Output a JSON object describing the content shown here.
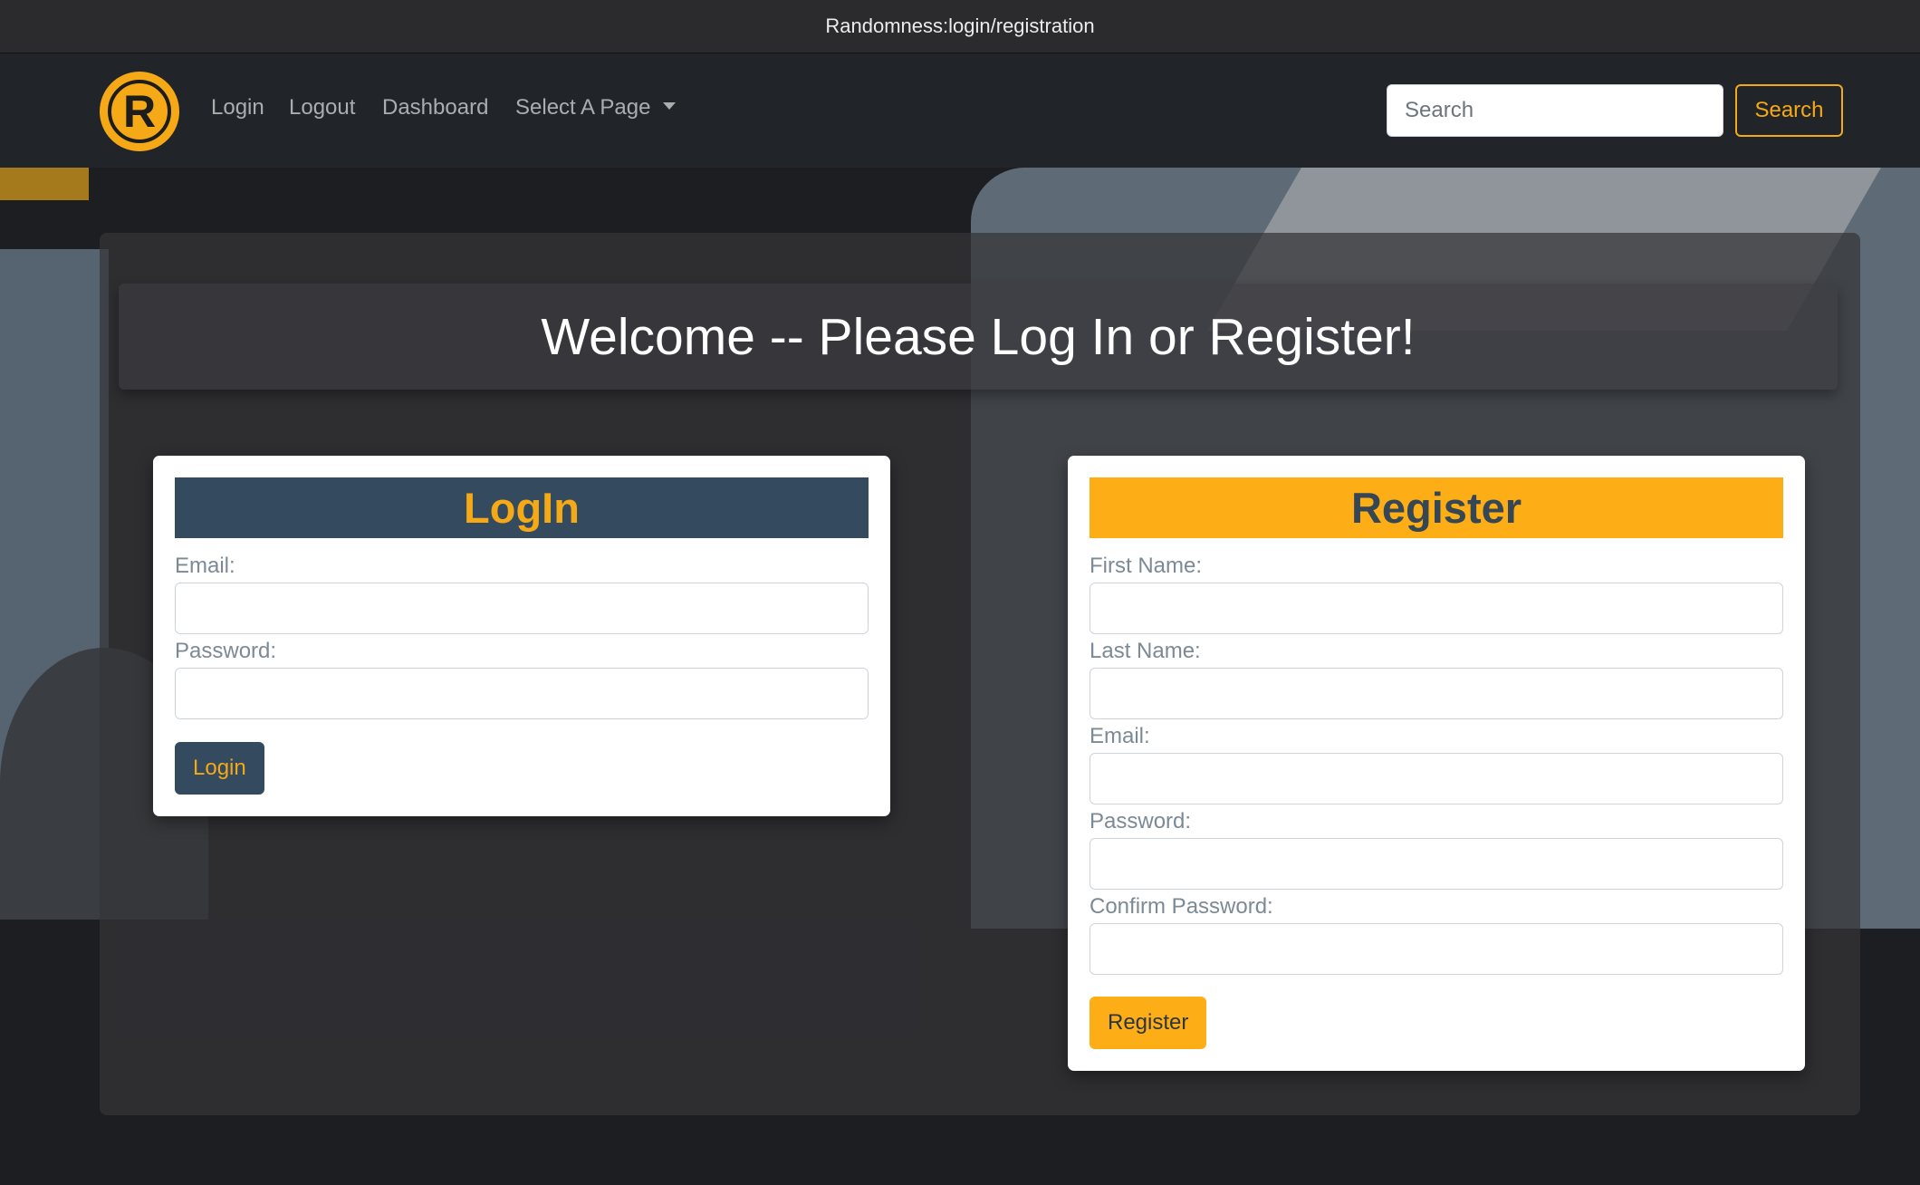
{
  "window": {
    "title": "Randomness:login/registration"
  },
  "navbar": {
    "logo_letter": "R",
    "links": [
      "Login",
      "Logout",
      "Dashboard"
    ],
    "dropdown_label": "Select A Page",
    "search_placeholder": "Search",
    "search_button": "Search"
  },
  "main": {
    "welcome": "Welcome -- Please Log In or Register!"
  },
  "login": {
    "title": "LogIn",
    "email_label": "Email:",
    "password_label": "Password:",
    "submit": "Login"
  },
  "register": {
    "title": "Register",
    "first_name_label": "First Name:",
    "last_name_label": "Last Name:",
    "email_label": "Email:",
    "password_label": "Password:",
    "confirm_password_label": "Confirm Password:",
    "submit": "Register"
  },
  "colors": {
    "accent": "#f5a916",
    "login_header": "#344a5e",
    "register_header": "#fdad15",
    "navbar": "#212529"
  }
}
